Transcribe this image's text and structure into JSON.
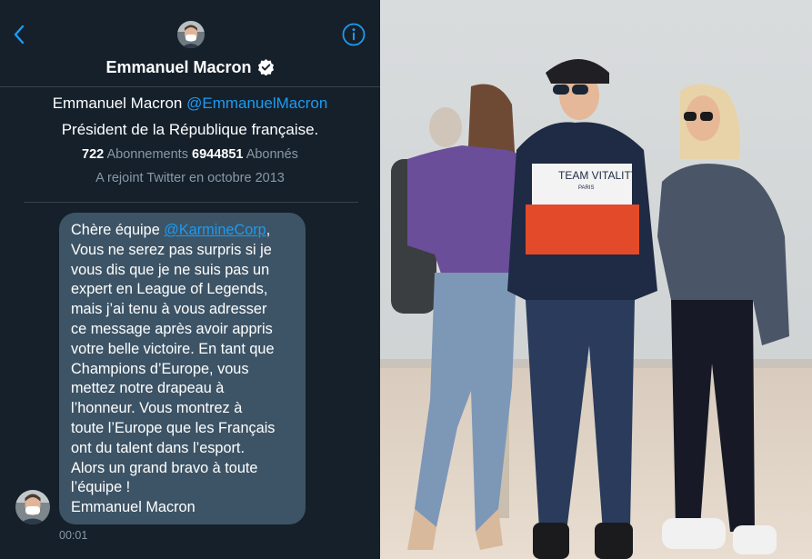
{
  "header": {
    "name": "Emmanuel Macron",
    "back_icon": "chevron-left-icon",
    "info_icon": "info-icon",
    "verified_icon": "verified-badge-icon"
  },
  "profile": {
    "name": "Emmanuel Macron",
    "handle": "@EmmanuelMacron",
    "bio": "Président de la République française.",
    "following_count": "722",
    "following_label": "Abonnements",
    "followers_count": "6944851",
    "followers_label": "Abonnés",
    "joined": "A rejoint Twitter en octobre 2013"
  },
  "message": {
    "greeting": "Chère équipe ",
    "mention": "@KarmineCorp",
    "greeting_end": ",",
    "lines": [
      "Vous ne serez pas surpris si je",
      "vous dis que je ne suis pas un",
      "expert en League of Legends,",
      "mais j’ai tenu à vous adresser",
      "ce message après avoir appris",
      "votre belle victoire. En tant que",
      "Champions d’Europe, vous",
      "mettez notre drapeau à",
      "l’honneur. Vous montrez à",
      "toute l’Europe que les Français",
      "ont du talent dans l’esport.",
      "Alors un grand bravo à toute",
      "l’équipe !",
      "Emmanuel Macron"
    ],
    "time": "00:01"
  },
  "photo": {
    "hoodie_text_line1": "TEAM VITALITY",
    "hoodie_text_line2": "PARIS"
  },
  "colors": {
    "background": "#15202b",
    "bubble": "#3d5466",
    "accent": "#1d9bf0",
    "muted": "#8899a6"
  }
}
